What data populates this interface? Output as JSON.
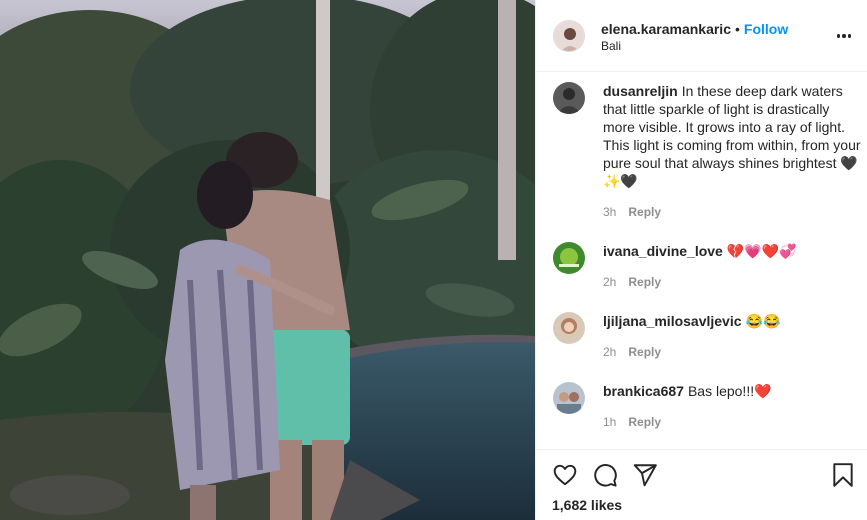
{
  "post": {
    "username": "elena.karamankaric",
    "separator": "•",
    "follow_label": "Follow",
    "location": "Bali",
    "likes_text": "1,682 likes"
  },
  "comments": [
    {
      "username": "dusanreljin",
      "text": "In these deep dark waters that little sparkle of light is drastically more visible. It grows into a ray of light. This light is coming from within, from your pure soul that always shines brightest 🖤✨🖤",
      "time": "3h",
      "reply_label": "Reply"
    },
    {
      "username": "ivana_divine_love",
      "text": "💔💗❤️💞",
      "time": "2h",
      "reply_label": "Reply"
    },
    {
      "username": "ljiljana_milosavljevic",
      "text": "😂😂",
      "time": "2h",
      "reply_label": "Reply"
    },
    {
      "username": "brankica687",
      "text": "Bas lepo!!!❤️",
      "time": "1h",
      "reply_label": "Reply"
    }
  ],
  "icons": {
    "like": "heart-icon",
    "comment": "comment-icon",
    "share": "paper-plane-icon",
    "save": "bookmark-icon",
    "more": "more-options-icon"
  },
  "colors": {
    "follow_blue": "#0095f6",
    "text": "#262626",
    "muted": "#8e8e8e",
    "border": "#efefef"
  }
}
